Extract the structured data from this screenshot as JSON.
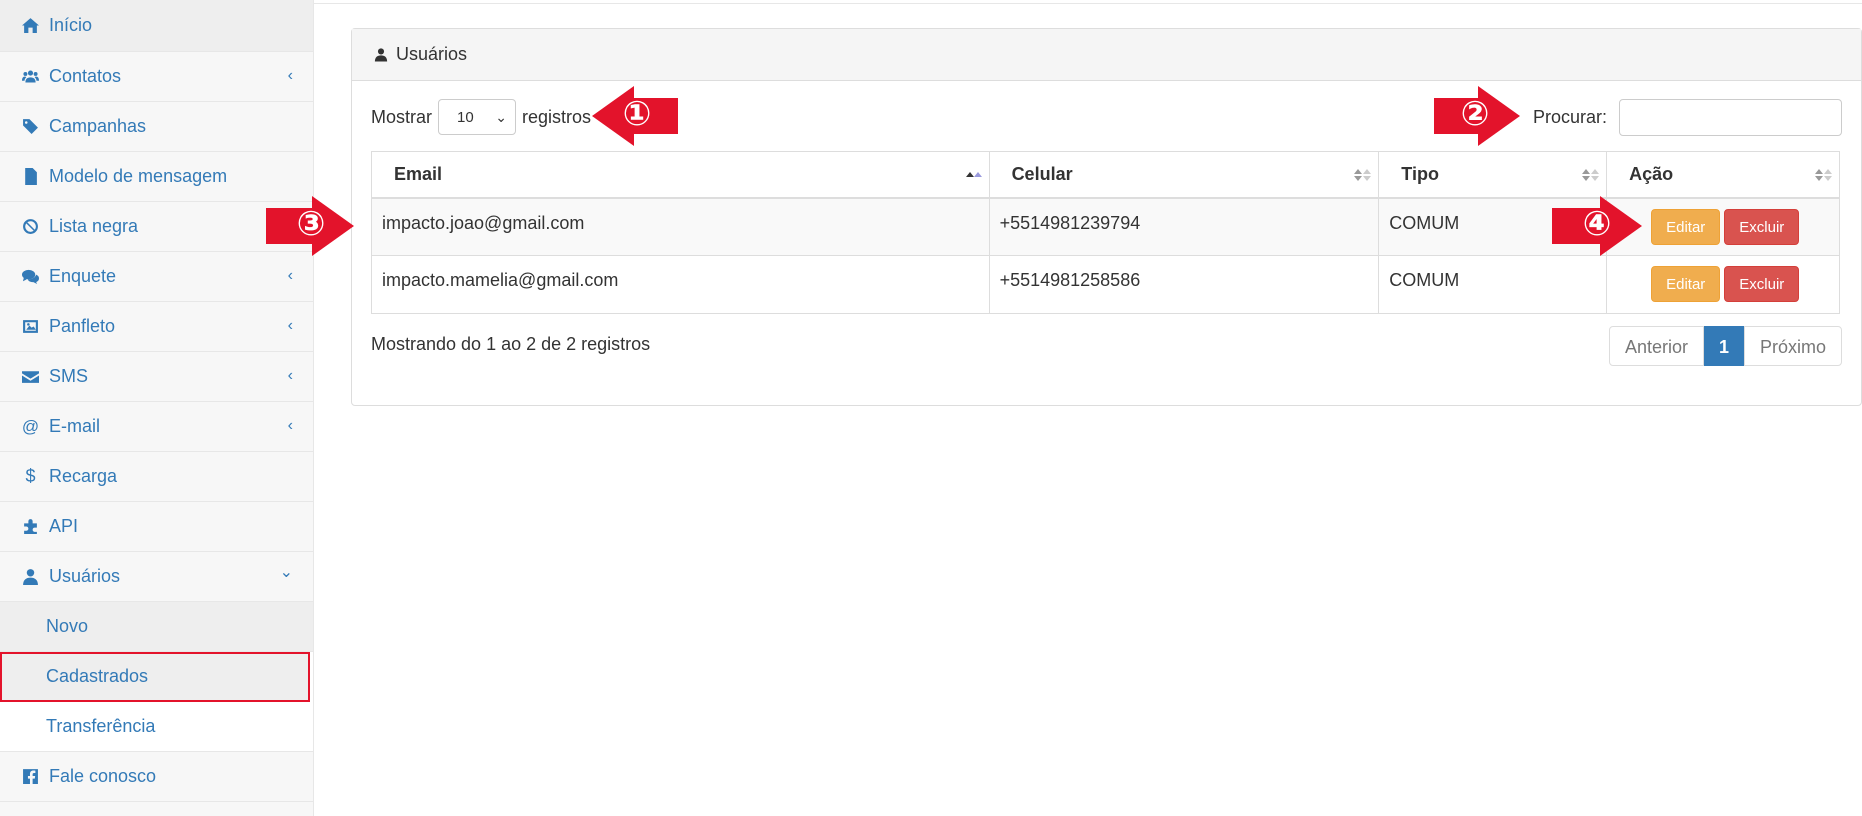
{
  "sidebar": {
    "items": [
      {
        "label": "Início",
        "icon": "home-icon"
      },
      {
        "label": "Contatos",
        "icon": "users-icon",
        "chevron": "‹"
      },
      {
        "label": "Campanhas",
        "icon": "tag-icon"
      },
      {
        "label": "Modelo de mensagem",
        "icon": "file-text-icon"
      },
      {
        "label": "Lista negra",
        "icon": "ban-icon"
      },
      {
        "label": "Enquete",
        "icon": "comments-icon",
        "chevron": "‹"
      },
      {
        "label": "Panfleto",
        "icon": "image-icon",
        "chevron": "‹"
      },
      {
        "label": "SMS",
        "icon": "envelope-icon",
        "chevron": "‹"
      },
      {
        "label": "E-mail",
        "icon": "at-icon",
        "chevron": "‹"
      },
      {
        "label": "Recarga",
        "icon": "dollar-icon"
      },
      {
        "label": "API",
        "icon": "puzzle-icon"
      },
      {
        "label": "Usuários",
        "icon": "user-icon",
        "chevron": "⌄"
      }
    ],
    "sub_items": [
      {
        "label": "Novo"
      },
      {
        "label": "Cadastrados"
      },
      {
        "label": "Transferência"
      }
    ],
    "footer_item": {
      "label": "Fale conosco",
      "icon": "facebook-icon"
    }
  },
  "panel": {
    "title": "Usuários",
    "show_label": "Mostrar",
    "page_size": "10",
    "records_label": "registros",
    "search_label": "Procurar:",
    "search_value": ""
  },
  "table": {
    "columns": [
      "Email",
      "Celular",
      "Tipo",
      "Ação"
    ],
    "rows": [
      {
        "email": "impacto.joao@gmail.com",
        "celular": "+5514981239794",
        "tipo": "COMUM",
        "edit": "Editar",
        "delete": "Excluir"
      },
      {
        "email": "impacto.mamelia@gmail.com",
        "celular": "+5514981258586",
        "tipo": "COMUM",
        "edit": "Editar",
        "delete": "Excluir"
      }
    ]
  },
  "footer": {
    "info": "Mostrando do 1 ao 2 de 2 registros",
    "prev": "Anterior",
    "current": "1",
    "next": "Próximo"
  },
  "annotations": [
    "①",
    "②",
    "③",
    "④"
  ],
  "colors": {
    "link": "#337ab7",
    "edit": "#f0ad4e",
    "delete": "#d9534f",
    "arrow": "#e3132b"
  }
}
